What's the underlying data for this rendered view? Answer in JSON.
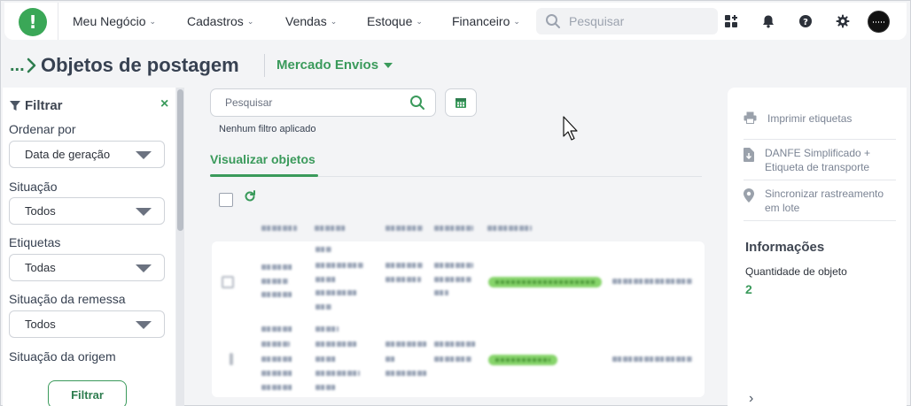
{
  "nav": {
    "logo_glyph": "!",
    "items": [
      {
        "label": "Meu Negócio"
      },
      {
        "label": "Cadastros"
      },
      {
        "label": "Vendas"
      },
      {
        "label": "Estoque"
      },
      {
        "label": "Financeiro"
      }
    ],
    "search_placeholder": "Pesquisar"
  },
  "header": {
    "breadcrumb_dots": "...",
    "title": "Objetos de postagem",
    "channel": "Mercado Envios"
  },
  "filter": {
    "title": "Filtrar",
    "close": "×",
    "fields": [
      {
        "label": "Ordenar por",
        "value": "Data de geração"
      },
      {
        "label": "Situação",
        "value": "Todos"
      },
      {
        "label": "Etiquetas",
        "value": "Todas"
      },
      {
        "label": "Situação da remessa",
        "value": "Todos"
      },
      {
        "label": "Situação da origem",
        "value": ""
      }
    ],
    "apply_label": "Filtrar"
  },
  "main": {
    "search_placeholder": "Pesquisar",
    "no_filter_text": "Nenhum filtro aplicado",
    "tab_label": "Visualizar objetos"
  },
  "actions": [
    {
      "label": "Imprimir etiquetas",
      "icon": "printer-icon"
    },
    {
      "label": "DANFE Simplificado + Etiqueta de transporte",
      "icon": "file-download-icon"
    },
    {
      "label": "Sincronizar rastreamento em lote",
      "icon": "map-pin-icon"
    }
  ],
  "info": {
    "title": "Informações",
    "quantity_label": "Quantidade de objeto",
    "quantity_value": "2"
  },
  "colors": {
    "brand_green": "#3a9a5b",
    "background": "#f3f4f6",
    "text": "#374151"
  }
}
